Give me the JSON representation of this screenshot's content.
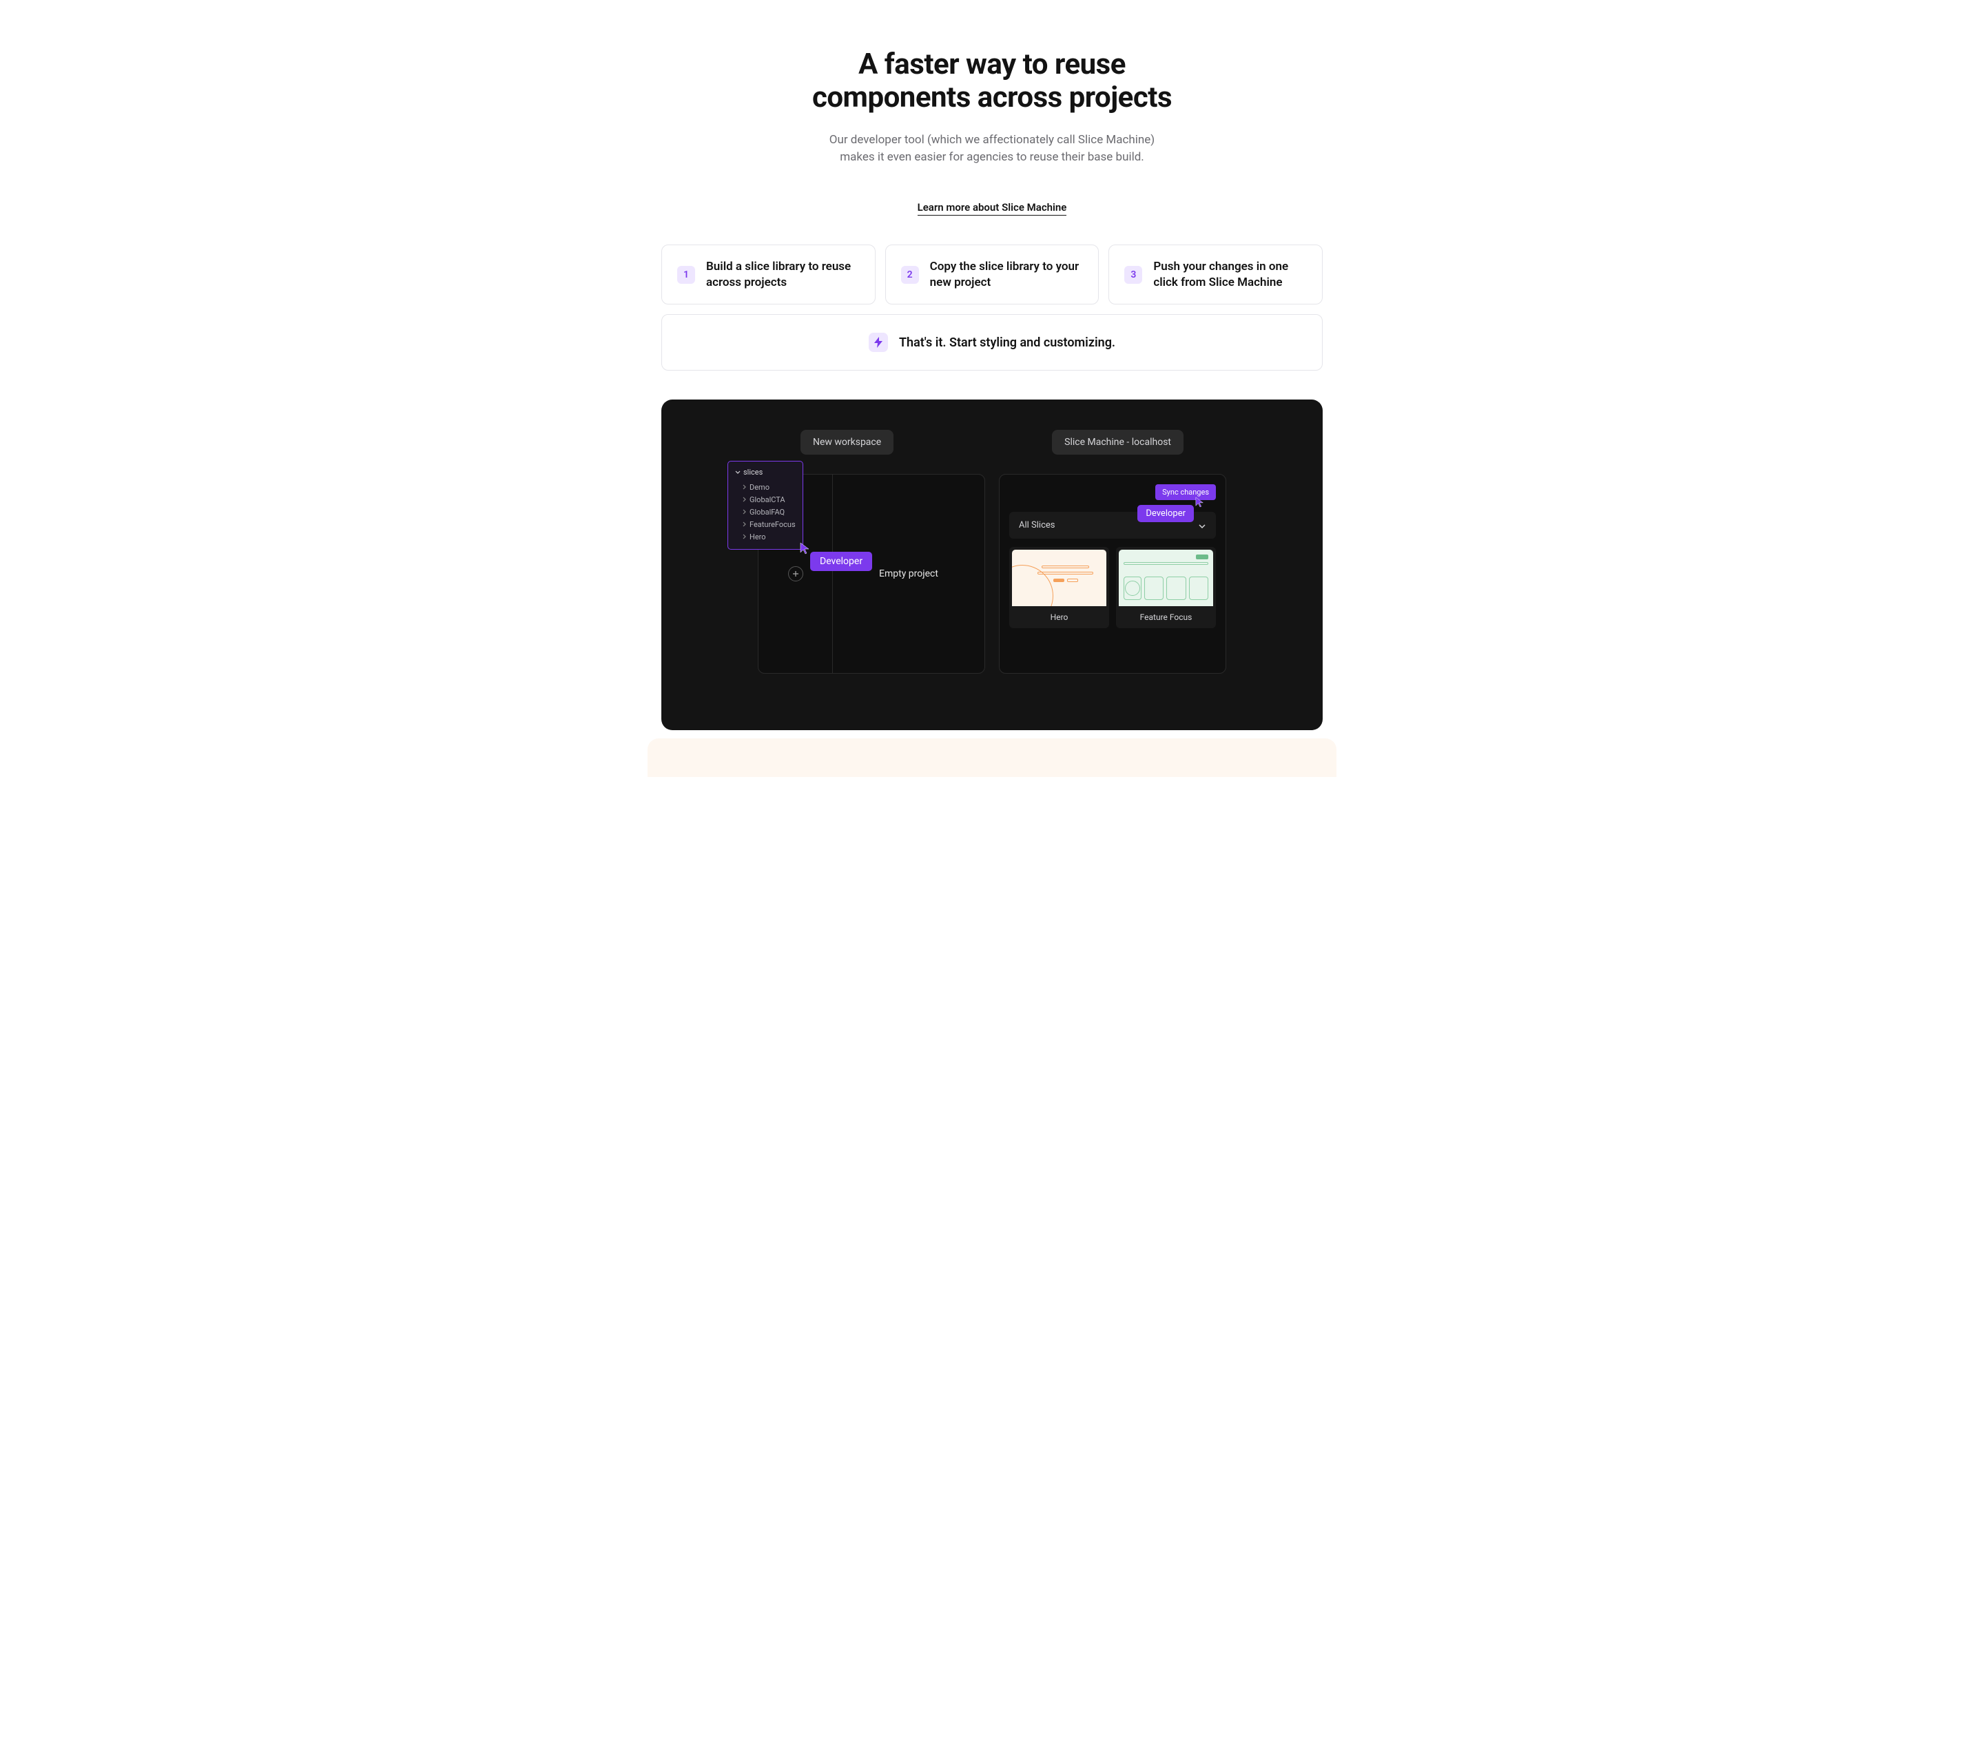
{
  "hero": {
    "title_l1": "A faster way to reuse",
    "title_l2": "components across projects",
    "subtitle": "Our developer tool (which we affectionately call Slice Machine) makes it even easier for agencies to reuse their base build.",
    "cta": "Learn more about Slice Machine"
  },
  "steps": [
    {
      "num": "1",
      "text": "Build a slice library to reuse across projects"
    },
    {
      "num": "2",
      "text": "Copy the slice library to your new project"
    },
    {
      "num": "3",
      "text": "Push your changes in one click from Slice Machine"
    }
  ],
  "final": "That's it. Start styling and customizing.",
  "panel": {
    "tab_left": "New workspace",
    "tab_right": "Slice Machine - localhost",
    "file_tree": {
      "root": "slices",
      "items": [
        "Demo",
        "GlobalCTA",
        "GlobalFAQ",
        "FeatureFocus",
        "Hero"
      ]
    },
    "empty_project": "Empty project",
    "developer_tag": "Developer",
    "sync_button": "Sync changes",
    "dropdown": "All Slices",
    "slices": [
      "Hero",
      "Feature Focus"
    ]
  }
}
